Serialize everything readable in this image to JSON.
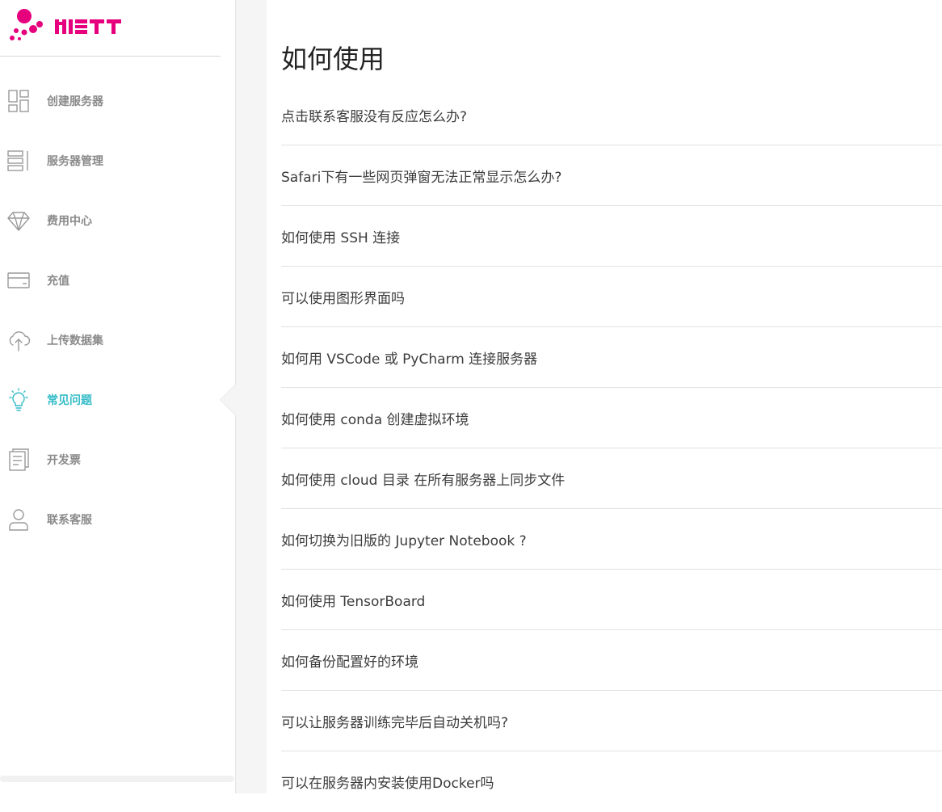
{
  "brand": {
    "logo_text": "MIST",
    "accent": "#e6007e",
    "active_color": "#35bcc7"
  },
  "sidebar": {
    "items": [
      {
        "label": "创建服务器",
        "icon": "dashboard-grid-icon",
        "active": false
      },
      {
        "label": "服务器管理",
        "icon": "server-list-icon",
        "active": false
      },
      {
        "label": "费用中心",
        "icon": "diamond-icon",
        "active": false
      },
      {
        "label": "充值",
        "icon": "credit-card-icon",
        "active": false
      },
      {
        "label": "上传数据集",
        "icon": "cloud-upload-icon",
        "active": false
      },
      {
        "label": "常见问题",
        "icon": "lightbulb-icon",
        "active": true
      },
      {
        "label": "开发票",
        "icon": "document-icon",
        "active": false
      },
      {
        "label": "联系客服",
        "icon": "user-icon",
        "active": false
      }
    ]
  },
  "main": {
    "title": "如何使用",
    "faqs": [
      "点击联系客服没有反应怎么办?",
      "Safari下有一些网页弹窗无法正常显示怎么办?",
      "如何使用 SSH 连接",
      "可以使用图形界面吗",
      "如何用 VSCode 或 PyCharm 连接服务器",
      "如何使用 conda 创建虚拟环境",
      "如何使用 cloud 目录 在所有服务器上同步文件",
      "如何切换为旧版的 Jupyter Notebook ?",
      "如何使用 TensorBoard",
      "如何备份配置好的环境",
      "可以让服务器训练完毕后自动关机吗?",
      "可以在服务器内安装使用Docker吗"
    ]
  }
}
